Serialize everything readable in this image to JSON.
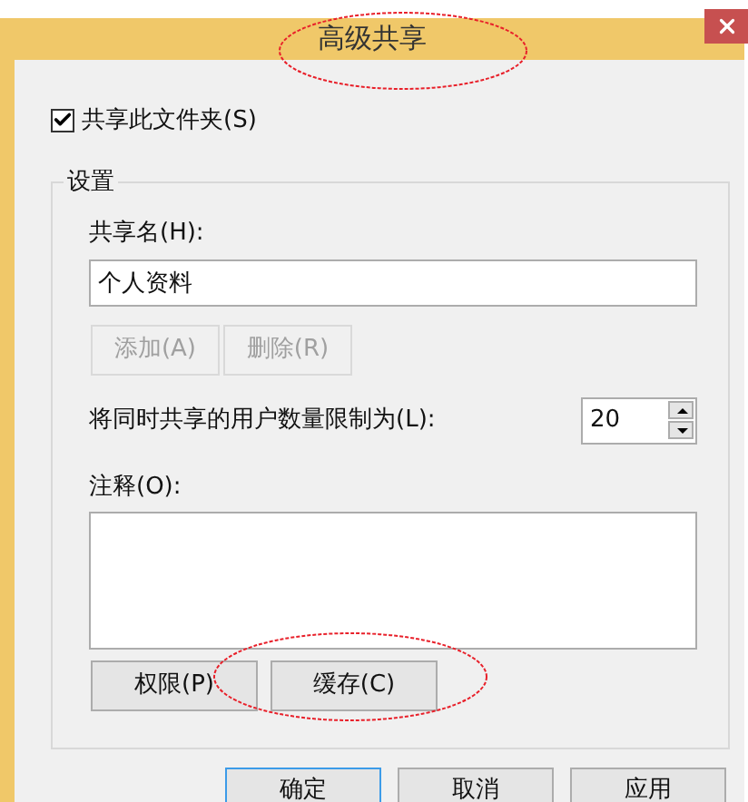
{
  "window": {
    "title": "高级共享"
  },
  "share_checkbox": {
    "label": "共享此文件夹(S)",
    "checked": true
  },
  "settings": {
    "title": "设置",
    "share_name_label": "共享名(H):",
    "share_name_value": "个人资料",
    "name_buttons": [
      {
        "label": "添加(A)",
        "disabled": true
      },
      {
        "label": "删除(R)",
        "disabled": true
      }
    ],
    "limit_label": "将同时共享的用户数量限制为(L):",
    "limit_value": "20",
    "comment_label": "注释(O):",
    "buttons": [
      {
        "label": "权限(P)",
        "disabled": false
      },
      {
        "label": "缓存(C)",
        "disabled": false
      }
    ]
  },
  "dialog_buttons": [
    {
      "label": "确定",
      "default": true
    },
    {
      "label": "取消",
      "default": false
    },
    {
      "label": "应用",
      "default": false
    }
  ]
}
